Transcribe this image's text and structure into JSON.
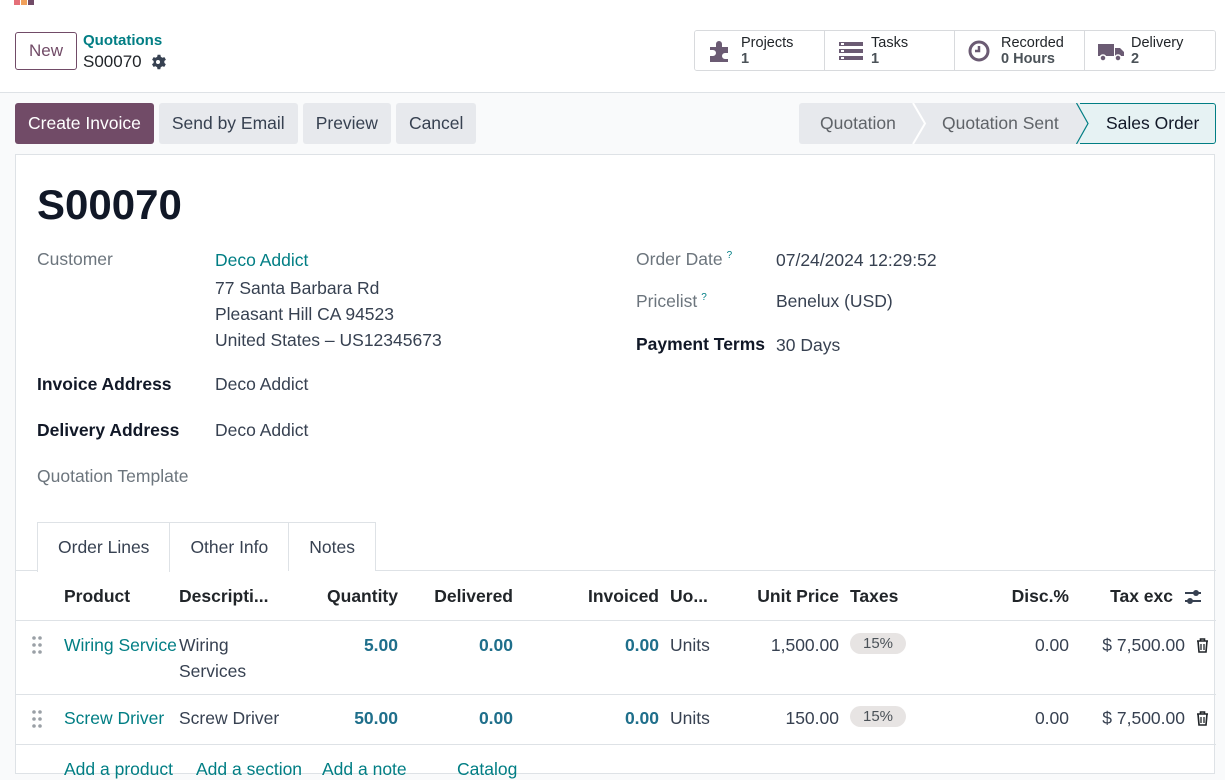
{
  "colors": {
    "brand": "#714B67",
    "link": "#017e84",
    "number": "#1f6f8b",
    "active_stage_bg": "#e6f2f3"
  },
  "control_panel": {
    "new_label": "New",
    "breadcrumb_parent": "Quotations",
    "breadcrumb_current": "S00070",
    "smart_buttons": [
      {
        "label": "Projects",
        "value": "1",
        "icon": "puzzle-icon"
      },
      {
        "label": "Tasks",
        "value": "1",
        "icon": "tasks-icon"
      },
      {
        "label": "Recorded",
        "value": "0 Hours",
        "icon": "clock-icon"
      },
      {
        "label": "Delivery",
        "value": "2",
        "icon": "truck-icon"
      }
    ]
  },
  "actions": {
    "create_invoice": "Create Invoice",
    "send_email": "Send by Email",
    "preview": "Preview",
    "cancel": "Cancel"
  },
  "statusbar": {
    "stages": [
      "Quotation",
      "Quotation Sent",
      "Sales Order"
    ],
    "active": "Sales Order"
  },
  "form": {
    "title": "S00070",
    "customer_label": "Customer",
    "customer_name": "Deco Addict",
    "customer_address": [
      "77 Santa Barbara Rd",
      "Pleasant Hill CA 94523",
      "United States – US12345673"
    ],
    "invoice_address_label": "Invoice Address",
    "invoice_address": "Deco Addict",
    "delivery_address_label": "Delivery Address",
    "delivery_address": "Deco Addict",
    "quotation_template_label": "Quotation Template",
    "order_date_label": "Order Date",
    "order_date": "07/24/2024 12:29:52",
    "pricelist_label": "Pricelist",
    "pricelist": "Benelux (USD)",
    "payment_terms_label": "Payment Terms",
    "payment_terms": "30 Days",
    "help_mark": "?"
  },
  "tabs": [
    "Order Lines",
    "Other Info",
    "Notes"
  ],
  "table": {
    "headers": [
      "Product",
      "Descripti...",
      "Quantity",
      "Delivered",
      "Invoiced",
      "Uo...",
      "Unit Price",
      "Taxes",
      "Disc.%",
      "Tax exc"
    ],
    "rows": [
      {
        "product": "Wiring Service",
        "description": [
          "Wiring",
          "Services"
        ],
        "quantity": "5.00",
        "delivered": "0.00",
        "invoiced": "0.00",
        "uom": "Units",
        "unit_price": "1,500.00",
        "tax": "15%",
        "discount": "0.00",
        "subtotal": "$ 7,500.00"
      },
      {
        "product": "Screw Driver",
        "description": [
          "Screw Driver"
        ],
        "quantity": "50.00",
        "delivered": "0.00",
        "invoiced": "0.00",
        "uom": "Units",
        "unit_price": "150.00",
        "tax": "15%",
        "discount": "0.00",
        "subtotal": "$ 7,500.00"
      }
    ],
    "add_links": [
      "Add a product",
      "Add a section",
      "Add a note",
      "Catalog"
    ]
  }
}
